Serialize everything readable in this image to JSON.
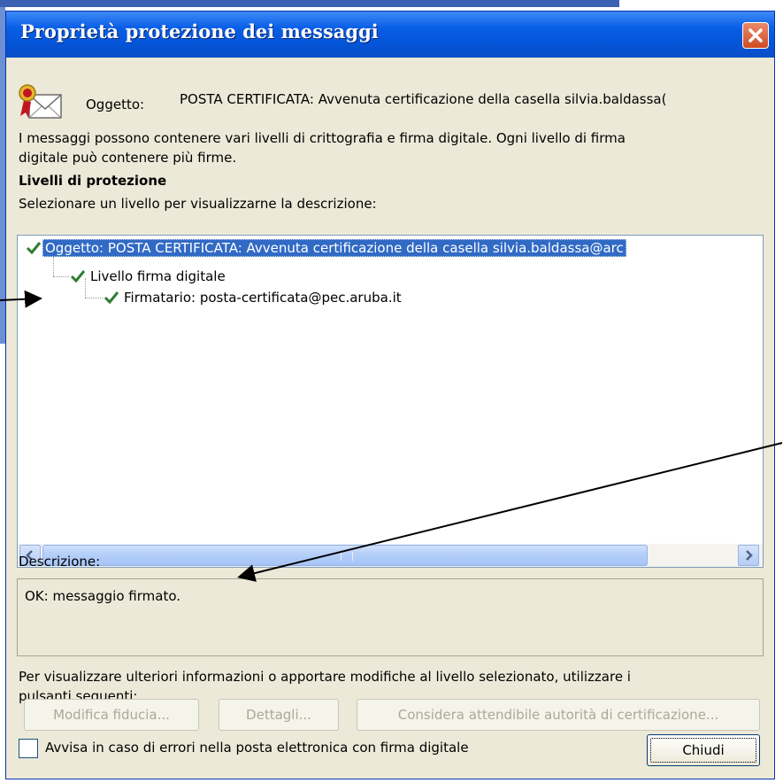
{
  "window": {
    "title": "Proprietà protezione dei messaggi"
  },
  "subject": {
    "label": "Oggetto:",
    "value": "POSTA CERTIFICATA: Avvenuta certificazione della casella silvia.baldassa("
  },
  "intro": {
    "line1": "I messaggi possono contenere vari livelli di crittografia e firma digitale. Ogni livello di firma",
    "line2": "digitale può contenere più firme."
  },
  "levels": {
    "heading": "Livelli di protezione",
    "instruction": "Selezionare un livello per visualizzarne la descrizione:",
    "tree": [
      {
        "label": "Oggetto: POSTA CERTIFICATA: Avvenuta certificazione della casella silvia.baldassa@arc",
        "selected": true
      },
      {
        "label": "Livello firma digitale",
        "selected": false
      },
      {
        "label": "Firmatario: posta-certificata@pec.aruba.it",
        "selected": false
      }
    ]
  },
  "description": {
    "label": "Descrizione:",
    "text": "OK: messaggio firmato."
  },
  "footer_info": {
    "line1": "Per visualizzare ulteriori informazioni o apportare modifiche al livello selezionato, utilizzare i",
    "line2": "pulsanti seguenti:"
  },
  "buttons": {
    "edit_trust": "Modifica fiducia...",
    "details": "Dettagli...",
    "trust_ca": "Considera attendibile autorità di certificazione...",
    "close": "Chiudi"
  },
  "options": {
    "warn_label": "Avvisa in caso di errori nella posta elettronica con firma digitale",
    "warn_checked": false
  },
  "colors": {
    "titlebar": "#0454d8",
    "selection": "#316ac5",
    "check": "#2e7d32",
    "dialog_bg": "#ece9d8"
  }
}
